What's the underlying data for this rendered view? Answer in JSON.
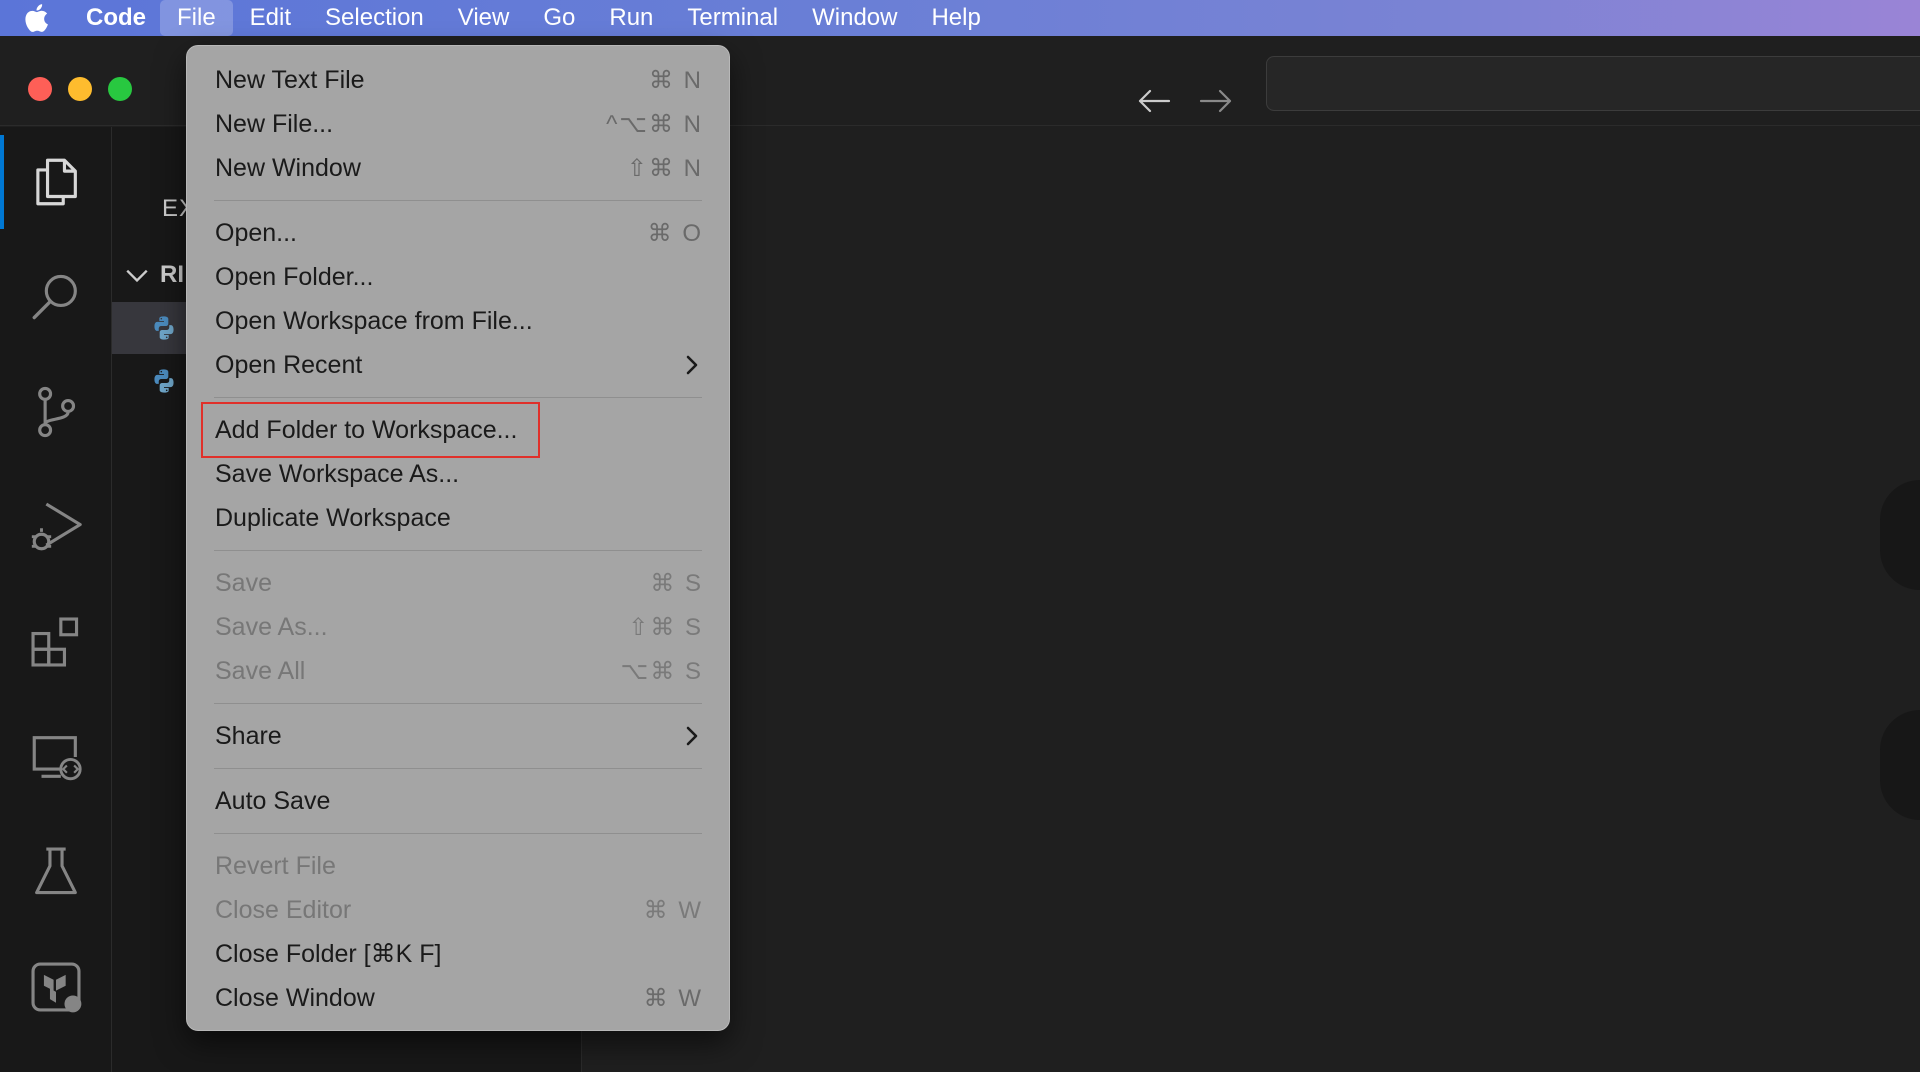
{
  "menubar": {
    "app_name": "Code",
    "items": [
      "File",
      "Edit",
      "Selection",
      "View",
      "Go",
      "Run",
      "Terminal",
      "Window",
      "Help"
    ],
    "active_item": "File"
  },
  "sidebar": {
    "title_fragment": "EX",
    "section_fragment": "RI"
  },
  "file_menu": {
    "groups": [
      [
        {
          "label": "New Text File",
          "shortcut": "⌘ N"
        },
        {
          "label": "New File...",
          "shortcut": "^⌥⌘ N"
        },
        {
          "label": "New Window",
          "shortcut": "⇧⌘ N"
        }
      ],
      [
        {
          "label": "Open...",
          "shortcut": "⌘ O"
        },
        {
          "label": "Open Folder...",
          "shortcut": ""
        },
        {
          "label": "Open Workspace from File...",
          "shortcut": ""
        },
        {
          "label": "Open Recent",
          "shortcut": "",
          "submenu": true
        }
      ],
      [
        {
          "label": "Add Folder to Workspace...",
          "shortcut": "",
          "highlighted": true
        },
        {
          "label": "Save Workspace As...",
          "shortcut": ""
        },
        {
          "label": "Duplicate Workspace",
          "shortcut": ""
        }
      ],
      [
        {
          "label": "Save",
          "shortcut": "⌘ S",
          "disabled": true
        },
        {
          "label": "Save As...",
          "shortcut": "⇧⌘ S",
          "disabled": true
        },
        {
          "label": "Save All",
          "shortcut": "⌥⌘ S",
          "disabled": true
        }
      ],
      [
        {
          "label": "Share",
          "shortcut": "",
          "submenu": true
        }
      ],
      [
        {
          "label": "Auto Save",
          "shortcut": ""
        }
      ],
      [
        {
          "label": "Revert File",
          "shortcut": "",
          "disabled": true
        },
        {
          "label": "Close Editor",
          "shortcut": "⌘ W",
          "disabled": true
        },
        {
          "label": "Close Folder [⌘K F]",
          "shortcut": ""
        },
        {
          "label": "Close Window",
          "shortcut": "⌘ W"
        }
      ]
    ]
  },
  "colors": {
    "highlight_border": "#e0302a",
    "accent": "#0078d4",
    "menu_bg": "#a5a5a5"
  }
}
